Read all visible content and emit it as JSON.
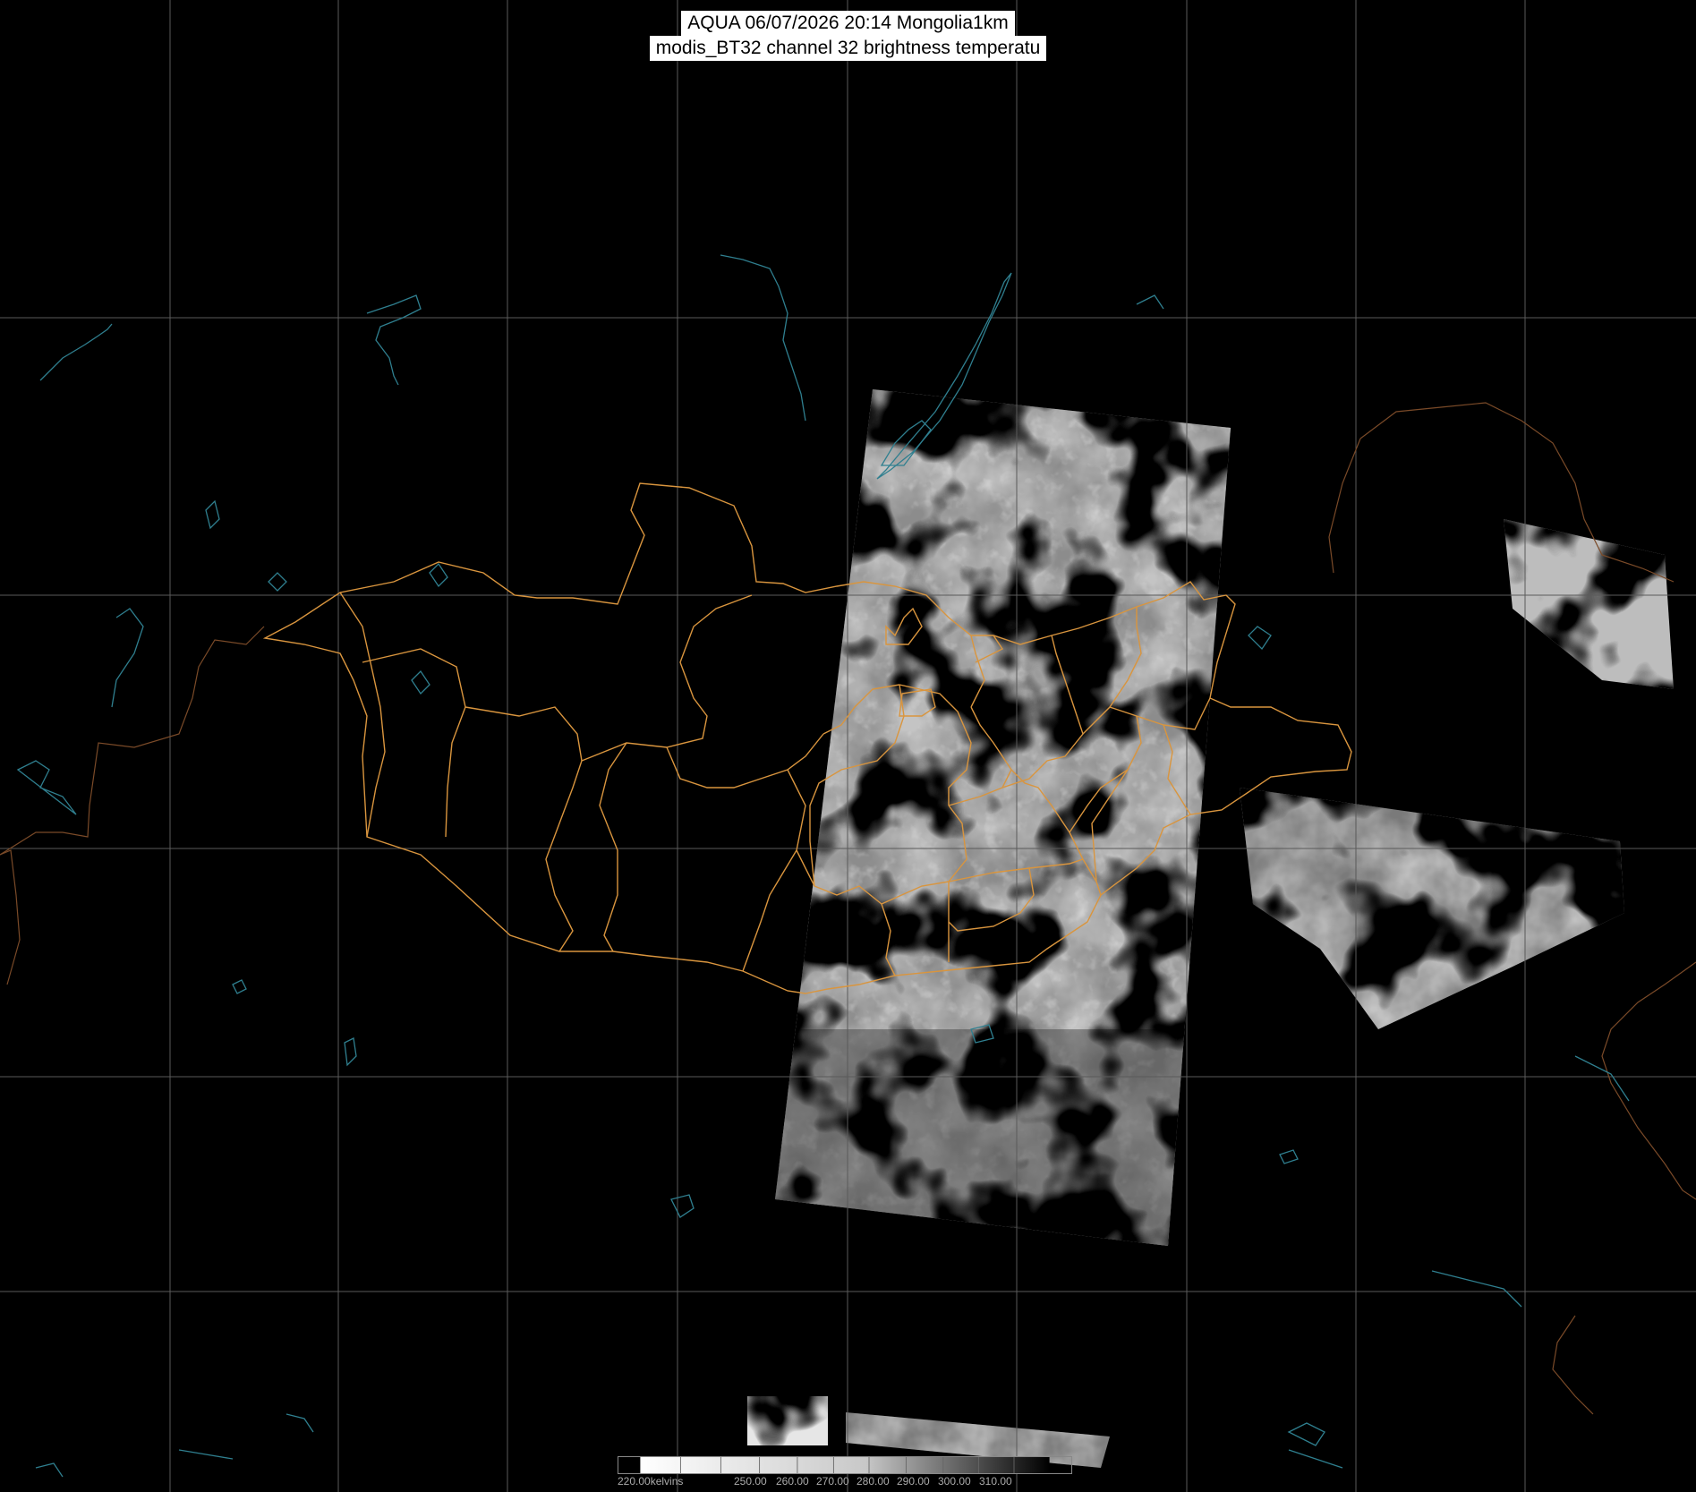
{
  "title": {
    "line1": "AQUA 06/07/2026 20:14 Mongolia1km",
    "line2": "modis_BT32 channel 32 brightness temperatu"
  },
  "colorbar": {
    "units_label": "220.00kelvins",
    "ticks": [
      "250.00",
      "260.00",
      "270.00",
      "280.00",
      "290.00",
      "300.00",
      "310.00"
    ]
  },
  "colors": {
    "background": "#000000",
    "grid": "#5a5a5a",
    "borders": "#d9953e",
    "water": "#2f7f8f",
    "coastline": "#7a4a28"
  }
}
